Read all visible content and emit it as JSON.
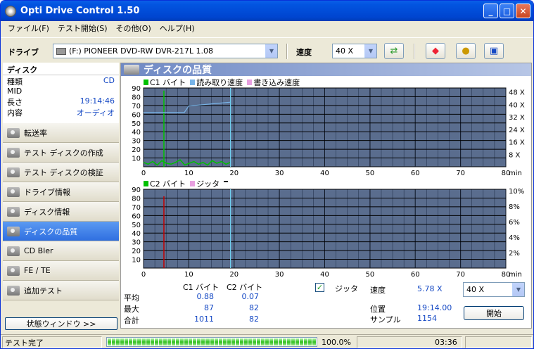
{
  "window": {
    "title": "Opti Drive Control 1.50"
  },
  "menu": [
    "ファイル(F)",
    "テスト開始(S)",
    "その他(O)",
    "ヘルプ(H)"
  ],
  "toolbar": {
    "drive_label": "ドライブ",
    "drive_value": "(F:)   PIONEER DVD-RW  DVR-217L 1.08",
    "speed_label": "速度",
    "speed_value": "40 X",
    "icons": [
      "refresh-icon",
      "eraser-icon",
      "media-icon",
      "save-icon"
    ]
  },
  "sidebar": {
    "disc_title": "ディスク",
    "info": [
      {
        "label": "種類",
        "value": "CD"
      },
      {
        "label": "MID",
        "value": ""
      },
      {
        "label": "長さ",
        "value": "19:14:46"
      },
      {
        "label": "内容",
        "value": "オーディオ"
      }
    ],
    "nav": [
      "転送率",
      "テスト ディスクの作成",
      "テスト ディスクの検証",
      "ドライブ情報",
      "ディスク情報",
      "ディスクの品質",
      "CD Bler",
      "FE / TE",
      "追加テスト"
    ],
    "active_index": 5,
    "status_window_button": "状態ウィンドウ >>"
  },
  "main": {
    "title": "ディスクの品質",
    "chart1_legend": [
      "C1 バイト",
      "読み取り速度",
      "書き込み速度"
    ],
    "chart2_legend": [
      "C2 バイト",
      "ジッタ"
    ],
    "stats": {
      "col_c1": "C1 バイト",
      "col_c2": "C2 バイト",
      "rows": [
        {
          "label": "平均",
          "c1": "0.88",
          "c2": "0.07"
        },
        {
          "label": "最大",
          "c1": "87",
          "c2": "82"
        },
        {
          "label": "合計",
          "c1": "1011",
          "c2": "82"
        }
      ],
      "jitter_label": "ジッタ",
      "jitter_checked": true,
      "speed_label": "速度",
      "speed_value": "5.78 X",
      "speed_select": "40 X",
      "position_label": "位置",
      "position_value": "19:14.00",
      "sample_label": "サンプル",
      "sample_value": "1154",
      "start_button": "開始"
    }
  },
  "statusbar": {
    "text": "テスト完了",
    "progress": "100.0%",
    "progress_fraction": 1.0,
    "time": "03:36"
  },
  "chart_data": [
    {
      "type": "bar",
      "title": "",
      "xlabel": "min",
      "x_ticks": [
        0,
        10,
        20,
        30,
        40,
        50,
        60,
        70,
        80
      ],
      "y_ticks": [
        10,
        20,
        30,
        40,
        50,
        60,
        70,
        80,
        90
      ],
      "right_ticks": [
        "8 X",
        "16 X",
        "24 X",
        "32 X",
        "40 X",
        "48 X"
      ],
      "xlim": [
        0,
        80
      ],
      "ylim": [
        0,
        90
      ],
      "series": [
        {
          "name": "C1 バイト",
          "color": "#00c000",
          "spikes": [
            {
              "x": 4.5,
              "y": 87
            }
          ],
          "baseline_values": [
            5,
            3,
            6,
            2,
            7,
            4,
            3,
            5,
            8,
            2,
            4,
            6,
            3,
            5,
            2,
            7,
            4,
            6,
            3,
            5
          ]
        },
        {
          "name": "読み取り速度",
          "color": "#78b4e8",
          "x": [
            0,
            9,
            10,
            19.2
          ],
          "y_speed": [
            5.8,
            5.8,
            6.5,
            6.9
          ]
        }
      ],
      "marker_x": 19.2
    },
    {
      "type": "bar",
      "title": "",
      "xlabel": "min",
      "x_ticks": [
        0,
        10,
        20,
        30,
        40,
        50,
        60,
        70,
        80
      ],
      "y_ticks": [
        10,
        20,
        30,
        40,
        50,
        60,
        70,
        80,
        90
      ],
      "right_ticks": [
        "2%",
        "4%",
        "6%",
        "8%",
        "10%"
      ],
      "xlim": [
        0,
        80
      ],
      "ylim": [
        0,
        90
      ],
      "series": [
        {
          "name": "C2 バイト",
          "color": "#c00000",
          "spikes": [
            {
              "x": 4.5,
              "y": 82
            }
          ]
        }
      ],
      "marker_x": 19.2
    }
  ],
  "colors": {
    "plot_bg": "#5a6d8e",
    "grid": "#000000",
    "accent": "#2f6fe0"
  }
}
